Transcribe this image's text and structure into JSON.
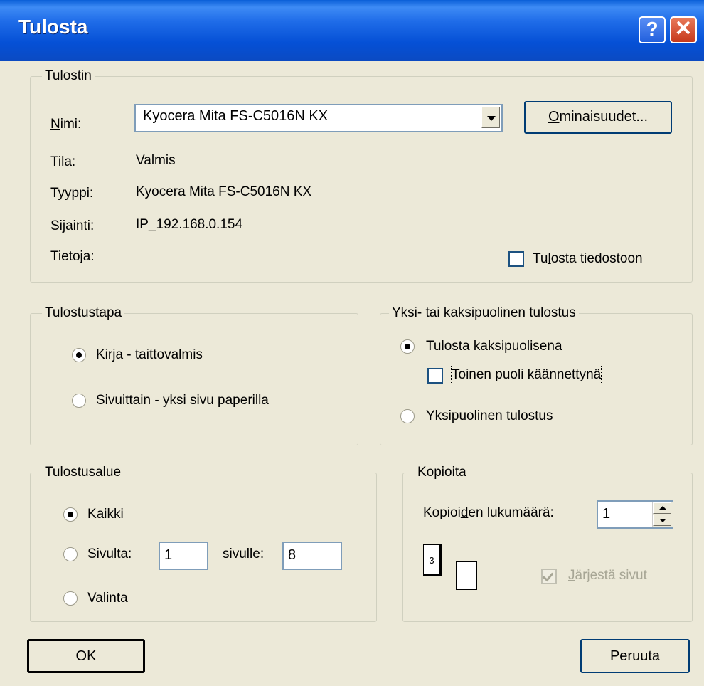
{
  "dialog": {
    "title": "Tulosta"
  },
  "titlebar": {
    "help_glyph": "?",
    "close_glyph": "✕"
  },
  "printer_group": {
    "legend": "Tulostin",
    "name_label": "Nimi:",
    "name_value": "Kyocera Mita FS-C5016N KX",
    "properties_button": "Ominaisuudet...",
    "status_label": "Tila:",
    "status_value": "Valmis",
    "type_label": "Tyyppi:",
    "type_value": "Kyocera Mita FS-C5016N KX",
    "location_label": "Sijainti:",
    "location_value": "IP_192.168.0.154",
    "comment_label": "Tietoja:",
    "print_to_file": "Tulosta tiedostoon"
  },
  "method_group": {
    "legend": "Tulostustapa",
    "option_book": "Kirja - taittovalmis",
    "option_pages": "Sivuittain - yksi sivu paperilla"
  },
  "duplex_group": {
    "legend": "Yksi- tai kaksipuolinen tulostus",
    "option_duplex": "Tulosta kaksipuolisena",
    "flip_checkbox": "Toinen puoli käännettynä",
    "option_simplex": "Yksipuolinen tulostus"
  },
  "range_group": {
    "legend": "Tulostusalue",
    "option_all": "Kaikki",
    "option_pages_from": "Sivulta:",
    "from_value": "1",
    "to_label": "sivulle:",
    "to_value": "8",
    "option_selection": "Valinta"
  },
  "copies_group": {
    "legend": "Kopioita",
    "count_label": "Kopioiden lukumäärä:",
    "count_value": "1",
    "page_icon_number": "3",
    "collate": "Järjestä sivut"
  },
  "buttons": {
    "ok": "OK",
    "cancel": "Peruuta"
  }
}
